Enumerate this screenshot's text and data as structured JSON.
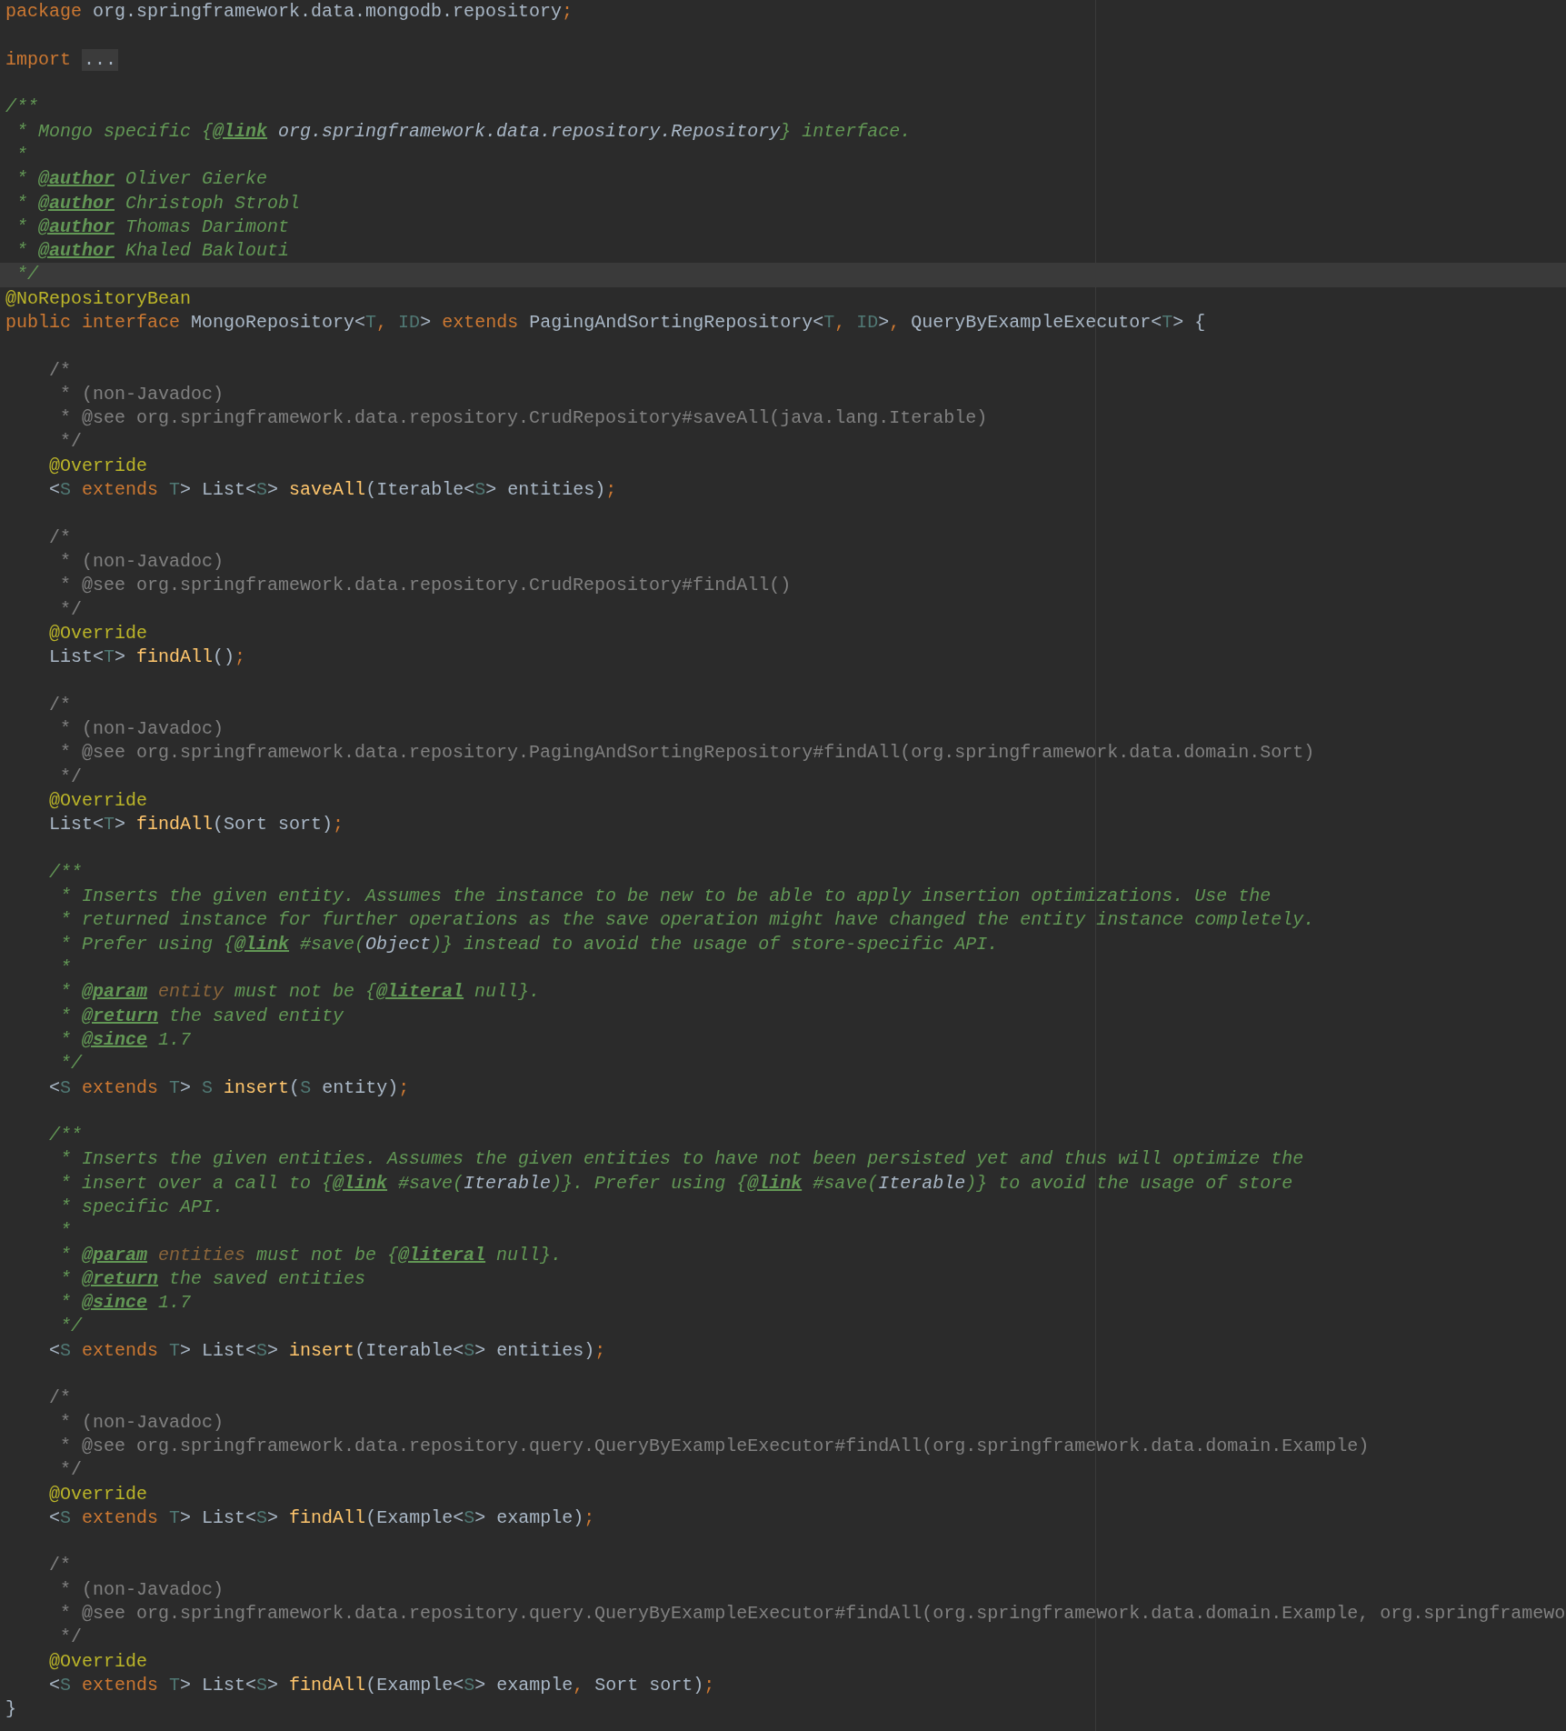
{
  "editor": {
    "blocks": [
      {
        "lines": [
          {
            "tokens": [
              {
                "kind": "kw",
                "text": "package"
              },
              {
                "kind": "plain",
                "text": " org.springframework.data.mongodb.repository"
              },
              {
                "kind": "punct",
                "text": ";"
              }
            ]
          }
        ]
      },
      {
        "lines": [
          {
            "tokens": [
              {
                "kind": "kw",
                "text": "import "
              },
              {
                "kind": "fold",
                "text": "..."
              }
            ]
          }
        ]
      },
      {
        "lines": [
          {
            "tokens": [
              {
                "kind": "doc",
                "text": "/**"
              }
            ]
          },
          {
            "tokens": [
              {
                "kind": "doc",
                "text": " * Mongo specific {"
              },
              {
                "kind": "doctag",
                "text": "@link"
              },
              {
                "kind": "docref",
                "text": " org.springframework.data.repository.Repository"
              },
              {
                "kind": "doc",
                "text": "} interface."
              }
            ]
          },
          {
            "tokens": [
              {
                "kind": "doc",
                "text": " *"
              }
            ]
          },
          {
            "tokens": [
              {
                "kind": "doc",
                "text": " * "
              },
              {
                "kind": "doctag",
                "text": "@author"
              },
              {
                "kind": "doc",
                "text": " Oliver Gierke"
              }
            ]
          },
          {
            "tokens": [
              {
                "kind": "doc",
                "text": " * "
              },
              {
                "kind": "doctag",
                "text": "@author"
              },
              {
                "kind": "doc",
                "text": " Christoph Strobl"
              }
            ]
          },
          {
            "tokens": [
              {
                "kind": "doc",
                "text": " * "
              },
              {
                "kind": "doctag",
                "text": "@author"
              },
              {
                "kind": "doc",
                "text": " Thomas Darimont"
              }
            ]
          },
          {
            "tokens": [
              {
                "kind": "doc",
                "text": " * "
              },
              {
                "kind": "doctag",
                "text": "@author"
              },
              {
                "kind": "doc",
                "text": " Khaled Baklouti"
              }
            ]
          },
          {
            "current": true,
            "tokens": [
              {
                "kind": "doc",
                "text": " */"
              }
            ]
          },
          {
            "tokens": [
              {
                "kind": "ann",
                "text": "@NoRepositoryBean"
              }
            ]
          },
          {
            "tokens": [
              {
                "kind": "kw",
                "text": "public interface"
              },
              {
                "kind": "plain",
                "text": " MongoRepository<"
              },
              {
                "kind": "tparam",
                "text": "T"
              },
              {
                "kind": "punct",
                "text": ","
              },
              {
                "kind": "tparam",
                "text": " ID"
              },
              {
                "kind": "plain",
                "text": "> "
              },
              {
                "kind": "kw",
                "text": "extends"
              },
              {
                "kind": "plain",
                "text": " PagingAndSortingRepository<"
              },
              {
                "kind": "tparam",
                "text": "T"
              },
              {
                "kind": "punct",
                "text": ","
              },
              {
                "kind": "tparam",
                "text": " ID"
              },
              {
                "kind": "plain",
                "text": ">"
              },
              {
                "kind": "punct",
                "text": ","
              },
              {
                "kind": "plain",
                "text": " QueryByExampleExecutor<"
              },
              {
                "kind": "tparam",
                "text": "T"
              },
              {
                "kind": "plain",
                "text": "> {"
              }
            ]
          }
        ]
      },
      {
        "lines": [
          {
            "tokens": [
              {
                "kind": "comment",
                "text": "    /*"
              }
            ]
          },
          {
            "tokens": [
              {
                "kind": "comment",
                "text": "     * (non-Javadoc)"
              }
            ]
          },
          {
            "tokens": [
              {
                "kind": "comment",
                "text": "     * @see org.springframework.data.repository.CrudRepository#saveAll(java.lang.Iterable)"
              }
            ]
          },
          {
            "tokens": [
              {
                "kind": "comment",
                "text": "     */"
              }
            ]
          },
          {
            "tokens": [
              {
                "kind": "ann",
                "text": "    @Override"
              }
            ]
          },
          {
            "tokens": [
              {
                "kind": "plain",
                "text": "    <"
              },
              {
                "kind": "tparam",
                "text": "S"
              },
              {
                "kind": "kw",
                "text": " extends"
              },
              {
                "kind": "tparam",
                "text": " T"
              },
              {
                "kind": "plain",
                "text": "> List<"
              },
              {
                "kind": "tparam",
                "text": "S"
              },
              {
                "kind": "plain",
                "text": "> "
              },
              {
                "kind": "method",
                "text": "saveAll"
              },
              {
                "kind": "plain",
                "text": "(Iterable<"
              },
              {
                "kind": "tparam",
                "text": "S"
              },
              {
                "kind": "plain",
                "text": "> entities)"
              },
              {
                "kind": "punct",
                "text": ";"
              }
            ]
          }
        ]
      },
      {
        "lines": [
          {
            "tokens": [
              {
                "kind": "comment",
                "text": "    /*"
              }
            ]
          },
          {
            "tokens": [
              {
                "kind": "comment",
                "text": "     * (non-Javadoc)"
              }
            ]
          },
          {
            "tokens": [
              {
                "kind": "comment",
                "text": "     * @see org.springframework.data.repository.CrudRepository#findAll()"
              }
            ]
          },
          {
            "tokens": [
              {
                "kind": "comment",
                "text": "     */"
              }
            ]
          },
          {
            "tokens": [
              {
                "kind": "ann",
                "text": "    @Override"
              }
            ]
          },
          {
            "tokens": [
              {
                "kind": "plain",
                "text": "    List<"
              },
              {
                "kind": "tparam",
                "text": "T"
              },
              {
                "kind": "plain",
                "text": "> "
              },
              {
                "kind": "method",
                "text": "findAll"
              },
              {
                "kind": "plain",
                "text": "()"
              },
              {
                "kind": "punct",
                "text": ";"
              }
            ]
          }
        ]
      },
      {
        "lines": [
          {
            "tokens": [
              {
                "kind": "comment",
                "text": "    /*"
              }
            ]
          },
          {
            "tokens": [
              {
                "kind": "comment",
                "text": "     * (non-Javadoc)"
              }
            ]
          },
          {
            "tokens": [
              {
                "kind": "comment",
                "text": "     * @see org.springframework.data.repository.PagingAndSortingRepository#findAll(org.springframework.data.domain.Sort)"
              }
            ]
          },
          {
            "tokens": [
              {
                "kind": "comment",
                "text": "     */"
              }
            ]
          },
          {
            "tokens": [
              {
                "kind": "ann",
                "text": "    @Override"
              }
            ]
          },
          {
            "tokens": [
              {
                "kind": "plain",
                "text": "    List<"
              },
              {
                "kind": "tparam",
                "text": "T"
              },
              {
                "kind": "plain",
                "text": "> "
              },
              {
                "kind": "method",
                "text": "findAll"
              },
              {
                "kind": "plain",
                "text": "(Sort sort)"
              },
              {
                "kind": "punct",
                "text": ";"
              }
            ]
          }
        ]
      },
      {
        "lines": [
          {
            "tokens": [
              {
                "kind": "doc",
                "text": "    /**"
              }
            ]
          },
          {
            "tokens": [
              {
                "kind": "doc",
                "text": "     * Inserts the given entity. Assumes the instance to be new to be able to apply insertion optimizations. Use the"
              }
            ]
          },
          {
            "tokens": [
              {
                "kind": "doc",
                "text": "     * returned instance for further operations as the save operation might have changed the entity instance completely."
              }
            ]
          },
          {
            "tokens": [
              {
                "kind": "doc",
                "text": "     * Prefer using {"
              },
              {
                "kind": "doctag",
                "text": "@link"
              },
              {
                "kind": "doc",
                "text": " #save("
              },
              {
                "kind": "docref",
                "text": "Object"
              },
              {
                "kind": "doc",
                "text": ")} instead to avoid the usage of store-specific API."
              }
            ]
          },
          {
            "tokens": [
              {
                "kind": "doc",
                "text": "     *"
              }
            ]
          },
          {
            "tokens": [
              {
                "kind": "doc",
                "text": "     * "
              },
              {
                "kind": "doctag",
                "text": "@param"
              },
              {
                "kind": "docparam",
                "text": " entity"
              },
              {
                "kind": "doc",
                "text": " must not be {"
              },
              {
                "kind": "doctag",
                "text": "@literal"
              },
              {
                "kind": "doc",
                "text": " null}."
              }
            ]
          },
          {
            "tokens": [
              {
                "kind": "doc",
                "text": "     * "
              },
              {
                "kind": "doctag",
                "text": "@return"
              },
              {
                "kind": "doc",
                "text": " the saved entity"
              }
            ]
          },
          {
            "tokens": [
              {
                "kind": "doc",
                "text": "     * "
              },
              {
                "kind": "doctag",
                "text": "@since"
              },
              {
                "kind": "doc",
                "text": " 1.7"
              }
            ]
          },
          {
            "tokens": [
              {
                "kind": "doc",
                "text": "     */"
              }
            ]
          },
          {
            "tokens": [
              {
                "kind": "plain",
                "text": "    <"
              },
              {
                "kind": "tparam",
                "text": "S"
              },
              {
                "kind": "kw",
                "text": " extends"
              },
              {
                "kind": "tparam",
                "text": " T"
              },
              {
                "kind": "plain",
                "text": "> "
              },
              {
                "kind": "tparam",
                "text": "S"
              },
              {
                "kind": "method",
                "text": " insert"
              },
              {
                "kind": "plain",
                "text": "("
              },
              {
                "kind": "tparam",
                "text": "S"
              },
              {
                "kind": "plain",
                "text": " entity)"
              },
              {
                "kind": "punct",
                "text": ";"
              }
            ]
          }
        ]
      },
      {
        "lines": [
          {
            "tokens": [
              {
                "kind": "doc",
                "text": "    /**"
              }
            ]
          },
          {
            "tokens": [
              {
                "kind": "doc",
                "text": "     * Inserts the given entities. Assumes the given entities to have not been persisted yet and thus will optimize the"
              }
            ]
          },
          {
            "tokens": [
              {
                "kind": "doc",
                "text": "     * insert over a call to {"
              },
              {
                "kind": "doctag",
                "text": "@link"
              },
              {
                "kind": "doc",
                "text": " #save("
              },
              {
                "kind": "docref",
                "text": "Iterable"
              },
              {
                "kind": "doc",
                "text": ")}. Prefer using {"
              },
              {
                "kind": "doctag",
                "text": "@link"
              },
              {
                "kind": "doc",
                "text": " #save("
              },
              {
                "kind": "docref",
                "text": "Iterable"
              },
              {
                "kind": "doc",
                "text": ")} to avoid the usage of store"
              }
            ]
          },
          {
            "tokens": [
              {
                "kind": "doc",
                "text": "     * specific API."
              }
            ]
          },
          {
            "tokens": [
              {
                "kind": "doc",
                "text": "     *"
              }
            ]
          },
          {
            "tokens": [
              {
                "kind": "doc",
                "text": "     * "
              },
              {
                "kind": "doctag",
                "text": "@param"
              },
              {
                "kind": "docparam",
                "text": " entities"
              },
              {
                "kind": "doc",
                "text": " must not be {"
              },
              {
                "kind": "doctag",
                "text": "@literal"
              },
              {
                "kind": "doc",
                "text": " null}."
              }
            ]
          },
          {
            "tokens": [
              {
                "kind": "doc",
                "text": "     * "
              },
              {
                "kind": "doctag",
                "text": "@return"
              },
              {
                "kind": "doc",
                "text": " the saved entities"
              }
            ]
          },
          {
            "tokens": [
              {
                "kind": "doc",
                "text": "     * "
              },
              {
                "kind": "doctag",
                "text": "@since"
              },
              {
                "kind": "doc",
                "text": " 1.7"
              }
            ]
          },
          {
            "tokens": [
              {
                "kind": "doc",
                "text": "     */"
              }
            ]
          },
          {
            "tokens": [
              {
                "kind": "plain",
                "text": "    <"
              },
              {
                "kind": "tparam",
                "text": "S"
              },
              {
                "kind": "kw",
                "text": " extends"
              },
              {
                "kind": "tparam",
                "text": " T"
              },
              {
                "kind": "plain",
                "text": "> List<"
              },
              {
                "kind": "tparam",
                "text": "S"
              },
              {
                "kind": "plain",
                "text": "> "
              },
              {
                "kind": "method",
                "text": "insert"
              },
              {
                "kind": "plain",
                "text": "(Iterable<"
              },
              {
                "kind": "tparam",
                "text": "S"
              },
              {
                "kind": "plain",
                "text": "> entities)"
              },
              {
                "kind": "punct",
                "text": ";"
              }
            ]
          }
        ]
      },
      {
        "lines": [
          {
            "tokens": [
              {
                "kind": "comment",
                "text": "    /*"
              }
            ]
          },
          {
            "tokens": [
              {
                "kind": "comment",
                "text": "     * (non-Javadoc)"
              }
            ]
          },
          {
            "tokens": [
              {
                "kind": "comment",
                "text": "     * @see org.springframework.data.repository.query.QueryByExampleExecutor#findAll(org.springframework.data.domain.Example)"
              }
            ]
          },
          {
            "tokens": [
              {
                "kind": "comment",
                "text": "     */"
              }
            ]
          },
          {
            "tokens": [
              {
                "kind": "ann",
                "text": "    @Override"
              }
            ]
          },
          {
            "tokens": [
              {
                "kind": "plain",
                "text": "    <"
              },
              {
                "kind": "tparam",
                "text": "S"
              },
              {
                "kind": "kw",
                "text": " extends"
              },
              {
                "kind": "tparam",
                "text": " T"
              },
              {
                "kind": "plain",
                "text": "> List<"
              },
              {
                "kind": "tparam",
                "text": "S"
              },
              {
                "kind": "plain",
                "text": "> "
              },
              {
                "kind": "method",
                "text": "findAll"
              },
              {
                "kind": "plain",
                "text": "(Example<"
              },
              {
                "kind": "tparam",
                "text": "S"
              },
              {
                "kind": "plain",
                "text": "> example)"
              },
              {
                "kind": "punct",
                "text": ";"
              }
            ]
          }
        ]
      },
      {
        "lines": [
          {
            "tokens": [
              {
                "kind": "comment",
                "text": "    /*"
              }
            ]
          },
          {
            "tokens": [
              {
                "kind": "comment",
                "text": "     * (non-Javadoc)"
              }
            ]
          },
          {
            "tokens": [
              {
                "kind": "comment",
                "text": "     * @see org.springframework.data.repository.query.QueryByExampleExecutor#findAll(org.springframework.data.domain.Example, org.springframewo"
              }
            ]
          },
          {
            "tokens": [
              {
                "kind": "comment",
                "text": "     */"
              }
            ]
          },
          {
            "tokens": [
              {
                "kind": "ann",
                "text": "    @Override"
              }
            ]
          },
          {
            "tokens": [
              {
                "kind": "plain",
                "text": "    <"
              },
              {
                "kind": "tparam",
                "text": "S"
              },
              {
                "kind": "kw",
                "text": " extends"
              },
              {
                "kind": "tparam",
                "text": " T"
              },
              {
                "kind": "plain",
                "text": "> List<"
              },
              {
                "kind": "tparam",
                "text": "S"
              },
              {
                "kind": "plain",
                "text": "> "
              },
              {
                "kind": "method",
                "text": "findAll"
              },
              {
                "kind": "plain",
                "text": "(Example<"
              },
              {
                "kind": "tparam",
                "text": "S"
              },
              {
                "kind": "plain",
                "text": "> example"
              },
              {
                "kind": "punct",
                "text": ","
              },
              {
                "kind": "plain",
                "text": " Sort sort)"
              },
              {
                "kind": "punct",
                "text": ";"
              }
            ]
          },
          {
            "tokens": [
              {
                "kind": "plain",
                "text": "}"
              }
            ]
          }
        ]
      }
    ]
  }
}
